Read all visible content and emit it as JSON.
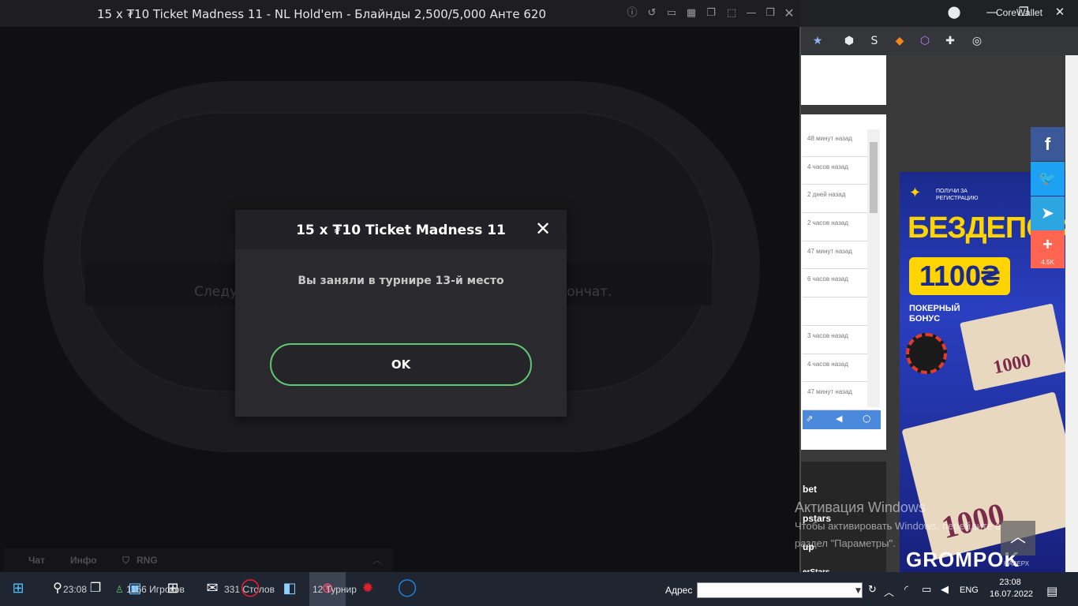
{
  "poker_window": {
    "title": "15 x ₮10 Ticket Madness 11 - NL Hold'em - Блайнды 2,500/5,000 Анте 620",
    "table_message_left": "Следу",
    "table_message_right": "кончат.",
    "bottom_tabs": [
      "Чат",
      "Инфо",
      "RNG"
    ]
  },
  "modal": {
    "title": "15 x ₮10 Ticket Madness 11",
    "close_symbol": "✕",
    "message": "Вы заняли в турнире 13-й место",
    "ok_label": "OK",
    "ok_border_color": "#5fc873"
  },
  "browser": {
    "extension_label": "CoreWallet",
    "list_times": [
      "48 минут назад",
      "4 часов назад",
      "2 дней назад",
      "2 часов назад",
      "47 минут назад",
      "6 часов назад",
      "",
      "3 часов назад",
      "4 часов назад",
      "47 минут назад"
    ],
    "site_labels": [
      "bet",
      "pstars",
      "up",
      "erStars"
    ],
    "ad": {
      "small_text": "ПОЛУЧИ ЗА РЕГИСТРАЦИЮ",
      "headline": "БЕЗДЕПОЗИ",
      "amount": "1100₴",
      "subtitle": "ПОКЕРНЫЙ БОНУС",
      "note_value": "1000",
      "brand": "GROMPOK"
    },
    "social": {
      "share_count": "4.5K"
    },
    "up_label": "НАВЕРХ"
  },
  "activation": {
    "title": "Активация Windows",
    "line1": "Чтобы активировать Windows, перейдите в",
    "line2": "раздел \"Параметры\"."
  },
  "taskbar": {
    "search_time": "23:08",
    "players_label": "1156 Игроков",
    "tables_label": "331 Столов",
    "tournaments_label": "12 Турнир",
    "address_label": "Адрес",
    "language": "ENG",
    "time": "23:08",
    "date": "16.07.2022"
  }
}
